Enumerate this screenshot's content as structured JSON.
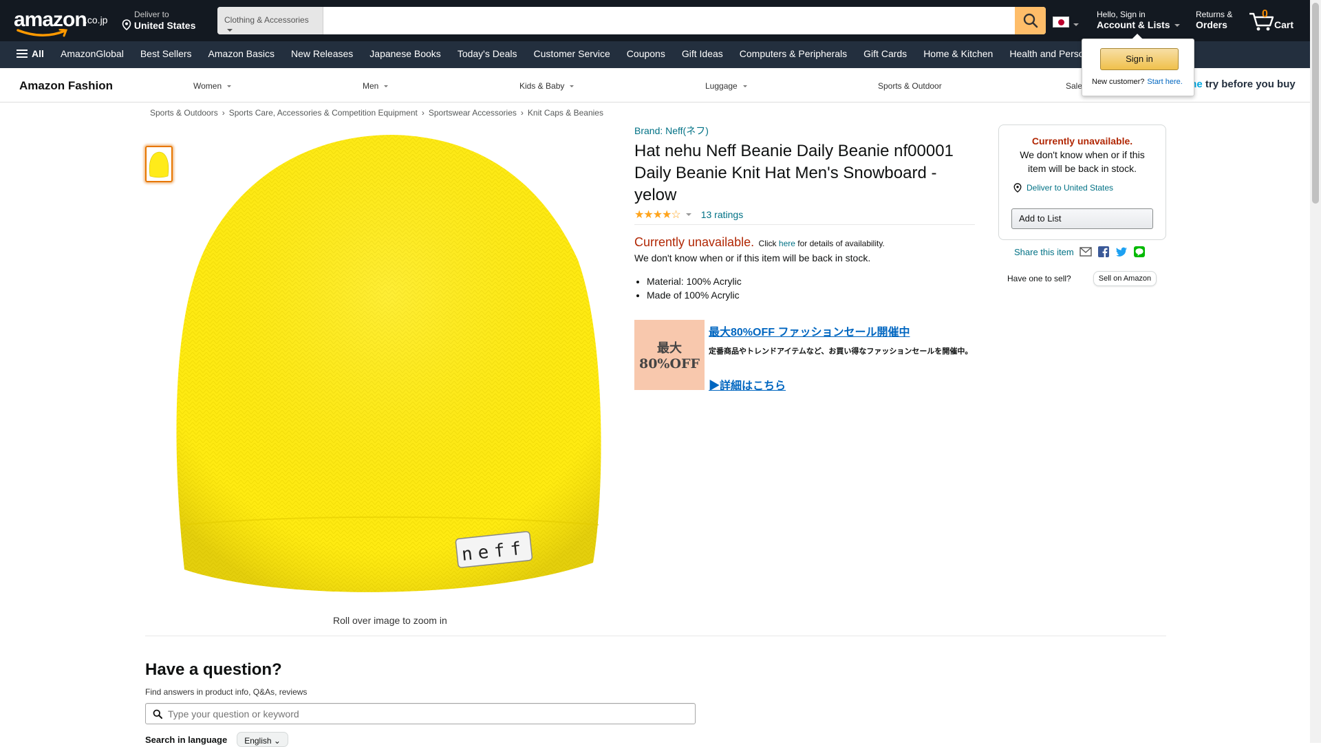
{
  "header": {
    "logo_text": "amazon",
    "logo_tld": ".co.jp",
    "deliver_line1": "Deliver to",
    "deliver_line2": "United States",
    "search_category": "Clothing & Accessories",
    "search_placeholder": "",
    "account_line1": "Hello, Sign in",
    "account_line2": "Account & Lists",
    "returns_line1": "Returns &",
    "returns_line2": "Orders",
    "cart_count": "0",
    "cart_label": "Cart"
  },
  "nav": {
    "all_label": "All",
    "items": [
      "AmazonGlobal",
      "Best Sellers",
      "Amazon Basics",
      "New Releases",
      "Japanese Books",
      "Today's Deals",
      "Customer Service",
      "Coupons",
      "Gift Ideas",
      "Computers & Peripherals",
      "Gift Cards",
      "Home & Kitchen",
      "Health and Perso"
    ]
  },
  "fashion_nav": {
    "brand": "Amazon Fashion",
    "categories": [
      "Women",
      "Men",
      "Kids & Baby",
      "Luggage",
      "Sports & Outdoor",
      "Sale"
    ],
    "tbyb_prefix": "me",
    "tbyb_rest": " try before you buy"
  },
  "flyout": {
    "sign_in": "Sign in",
    "new_customer": "New customer?",
    "start_here": "Start here."
  },
  "breadcrumb": [
    "Sports & Outdoors",
    "Sports Care, Accessories & Competition Equipment",
    "Sportswear Accessories",
    "Knit Caps & Beanies"
  ],
  "product": {
    "brand": "Brand: Neff(ネフ)",
    "title": "Hat nehu Neff Beanie Daily Beanie nf00001 Daily Beanie Knit Hat Men's Snowboard - yelow",
    "stars": "★★★★☆",
    "ratings": "13 ratings",
    "rating_value": 4,
    "unavailable": "Currently unavailable.",
    "click": "Click",
    "here": "here",
    "details": "for details of availability.",
    "info": "We don't know when or if this item will be back in stock.",
    "bullets": [
      "Material: 100% Acrylic",
      "Made of 100% Acrylic"
    ],
    "image_label": "neff",
    "zoom_note": "Roll over image to zoom in",
    "color_yellow": "#ffeb1a"
  },
  "promo": {
    "badge_line1": "最大",
    "badge_line2": "80%OFF",
    "headline": "最大80%OFF ファッションセール開催中",
    "description": "定番商品やトレンドアイテムなど、お買い得なファッションセールを開催中。",
    "more": "▶詳細はこちら"
  },
  "buybox": {
    "heading": "Currently unavailable.",
    "text": "We don't know when or if this item will be back in stock.",
    "deliver": "Deliver to United States",
    "add_to_list": "Add to List",
    "share": "Share this item",
    "have_one": "Have one to sell?",
    "sell_btn": "Sell on Amazon"
  },
  "qa": {
    "title": "Have a question?",
    "subtitle": "Find answers in product info, Q&As, reviews",
    "placeholder": "Type your question or keyword",
    "lang_label": "Search in language",
    "lang_value": "English"
  }
}
